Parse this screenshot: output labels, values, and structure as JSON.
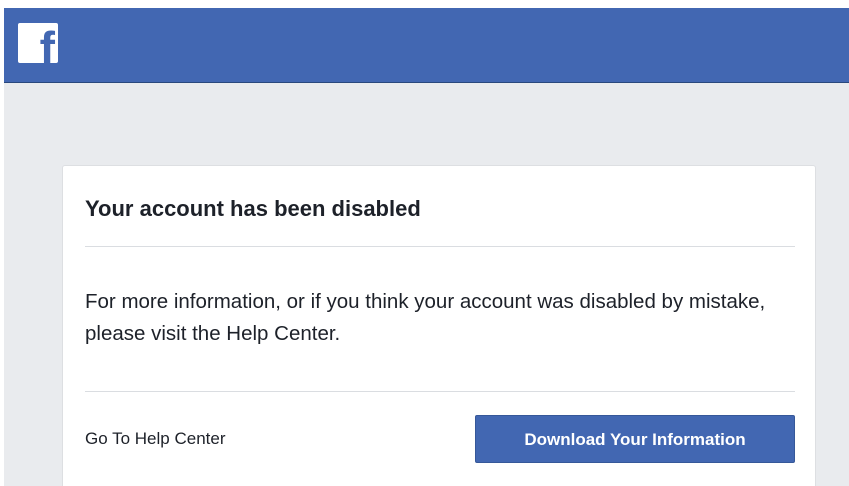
{
  "header": {
    "logo_letter": "f",
    "logo_icon": "facebook-logo-icon",
    "brand_color": "#4267b2"
  },
  "dialog": {
    "title": "Your account has been disabled",
    "message": "For more information, or if you think your account was disabled by mistake, please visit the Help Center.",
    "help_link_label": "Go To Help Center",
    "download_button_label": "Download Your Information"
  },
  "colors": {
    "page_background": "#e9ebee",
    "card_background": "#ffffff",
    "text": "#1d2129",
    "button": "#4267b2",
    "button_text": "#ffffff"
  }
}
